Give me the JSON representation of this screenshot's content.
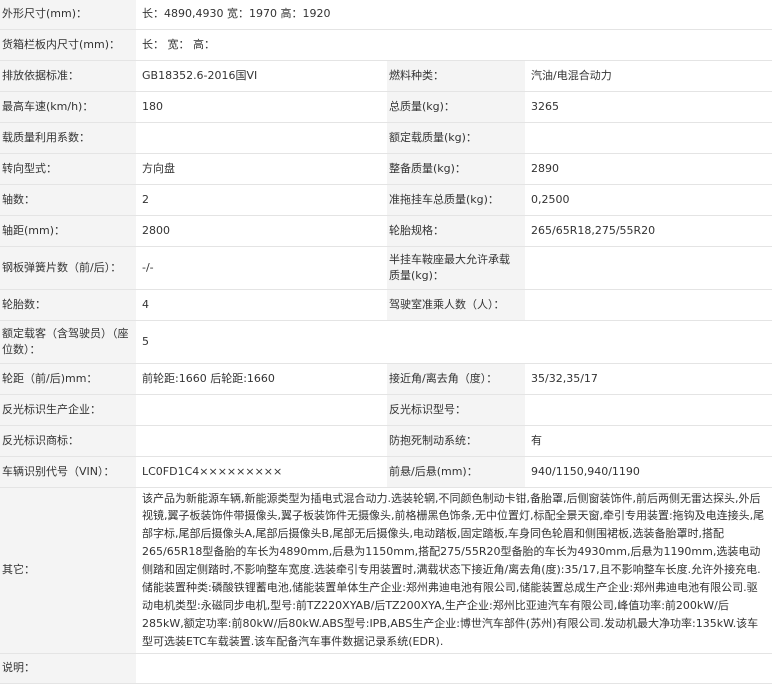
{
  "rows": {
    "r0": {
      "l1": "外形尺寸(mm)：",
      "v1": "长：4890,4930 宽：1970 高：1920"
    },
    "r1": {
      "l1": "货箱栏板内尺寸(mm)：",
      "v1": "长： 宽： 高："
    },
    "r2": {
      "l1": "排放依据标准：",
      "v1": "GB18352.6-2016国VI",
      "l2": "燃料种类：",
      "v2": "汽油/电混合动力"
    },
    "r3": {
      "l1": "最高车速(km/h)：",
      "v1": "180",
      "l2": "总质量(kg)：",
      "v2": "3265"
    },
    "r4": {
      "l1": "载质量利用系数：",
      "v1": "",
      "l2": "额定载质量(kg)：",
      "v2": ""
    },
    "r5": {
      "l1": "转向型式：",
      "v1": "方向盘",
      "l2": "整备质量(kg)：",
      "v2": "2890"
    },
    "r6": {
      "l1": "轴数：",
      "v1": "2",
      "l2": "准拖挂车总质量(kg)：",
      "v2": "0,2500"
    },
    "r7": {
      "l1": "轴距(mm)：",
      "v1": "2800",
      "l2": "轮胎规格：",
      "v2": "265/65R18,275/55R20"
    },
    "r8": {
      "l1": "钢板弹簧片数（前/后）：",
      "v1": "-/-",
      "l2": "半挂车鞍座最大允许承载质量(kg)：",
      "v2": ""
    },
    "r9": {
      "l1": "轮胎数：",
      "v1": "4",
      "l2": "驾驶室准乘人数（人）：",
      "v2": ""
    },
    "r10": {
      "l1": "额定载客（含驾驶员）（座位数）：",
      "v1": "5"
    },
    "r11": {
      "l1": "轮距（前/后)mm：",
      "v1": "前轮距:1660 后轮距:1660",
      "l2": "接近角/离去角（度）：",
      "v2": "35/32,35/17"
    },
    "r12": {
      "l1": "反光标识生产企业：",
      "v1": "",
      "l2": "反光标识型号：",
      "v2": ""
    },
    "r13": {
      "l1": "反光标识商标：",
      "v1": "",
      "l2": "防抱死制动系统：",
      "v2": "有"
    },
    "r14": {
      "l1": "车辆识别代号（VIN）：",
      "v1": "LC0FD1C4×××××××××",
      "l2": "前悬/后悬(mm)：",
      "v2": "940/1150,940/1190"
    },
    "r15": {
      "l1": "其它：",
      "v1": "该产品为新能源车辆,新能源类型为插电式混合动力.选装轮辋,不同颜色制动卡钳,备胎罩,后侧窗装饰件,前后两侧无雷达探头,外后视镜,翼子板装饰件带摄像头,翼子板装饰件无摄像头,前格栅黑色饰条,无中位置灯,标配全景天窗,牵引专用装置:拖钩及电连接头,尾部字标,尾部后摄像头A,尾部后摄像头B,尾部无后摄像头,电动踏板,固定踏板,车身同色轮眉和侧围裙板,选装备胎罩时,搭配265/65R18型备胎的车长为4890mm,后悬为1150mm,搭配275/55R20型备胎的车长为4930mm,后悬为1190mm,选装电动侧踏和固定侧踏时,不影响整车宽度.选装牵引专用装置时,满载状态下接近角/离去角(度):35/17,且不影响整车长度.允许外接充电.储能装置种类:磷酸铁锂蓄电池,储能装置单体生产企业:郑州弗迪电池有限公司,储能装置总成生产企业:郑州弗迪电池有限公司.驱动电机类型:永磁同步电机,型号:前TZ220XYAB/后TZ200XYA,生产企业:郑州比亚迪汽车有限公司,峰值功率:前200kW/后285kW,额定功率:前80kW/后80kW.ABS型号:IPB,ABS生产企业:博世汽车部件(苏州)有限公司.发动机最大净功率:135kW.该车型可选装ETC车载装置.该车配备汽车事件数据记录系统(EDR)."
    },
    "r16": {
      "l1": "说明：",
      "v1": ""
    }
  }
}
